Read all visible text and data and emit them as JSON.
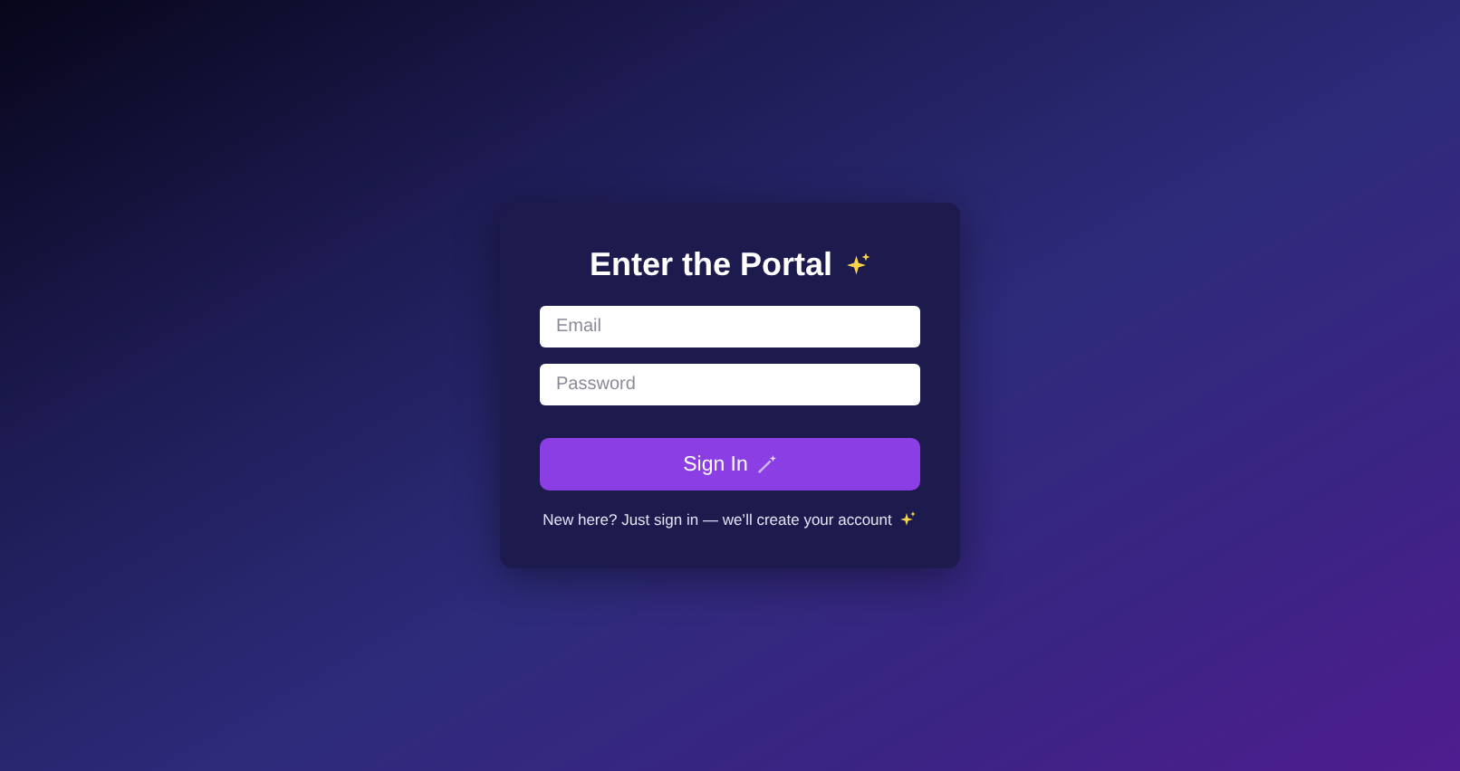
{
  "card": {
    "title": "Enter the Portal",
    "fields": [
      {
        "placeholder": "Email"
      },
      {
        "placeholder": "Password"
      }
    ],
    "button": "Sign In",
    "note": "New here? Just sign in — we’ll create your account"
  }
}
